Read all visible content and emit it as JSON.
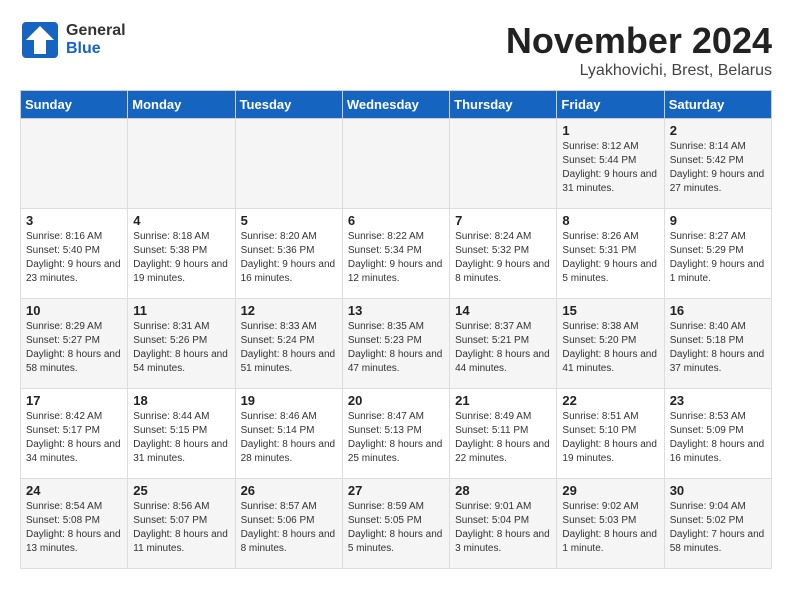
{
  "logo": {
    "general": "General",
    "blue": "Blue"
  },
  "header": {
    "month": "November 2024",
    "location": "Lyakhovichi, Brest, Belarus"
  },
  "weekdays": [
    "Sunday",
    "Monday",
    "Tuesday",
    "Wednesday",
    "Thursday",
    "Friday",
    "Saturday"
  ],
  "weeks": [
    [
      {
        "day": "",
        "info": ""
      },
      {
        "day": "",
        "info": ""
      },
      {
        "day": "",
        "info": ""
      },
      {
        "day": "",
        "info": ""
      },
      {
        "day": "",
        "info": ""
      },
      {
        "day": "1",
        "info": "Sunrise: 8:12 AM\nSunset: 5:44 PM\nDaylight: 9 hours and 31 minutes."
      },
      {
        "day": "2",
        "info": "Sunrise: 8:14 AM\nSunset: 5:42 PM\nDaylight: 9 hours and 27 minutes."
      }
    ],
    [
      {
        "day": "3",
        "info": "Sunrise: 8:16 AM\nSunset: 5:40 PM\nDaylight: 9 hours and 23 minutes."
      },
      {
        "day": "4",
        "info": "Sunrise: 8:18 AM\nSunset: 5:38 PM\nDaylight: 9 hours and 19 minutes."
      },
      {
        "day": "5",
        "info": "Sunrise: 8:20 AM\nSunset: 5:36 PM\nDaylight: 9 hours and 16 minutes."
      },
      {
        "day": "6",
        "info": "Sunrise: 8:22 AM\nSunset: 5:34 PM\nDaylight: 9 hours and 12 minutes."
      },
      {
        "day": "7",
        "info": "Sunrise: 8:24 AM\nSunset: 5:32 PM\nDaylight: 9 hours and 8 minutes."
      },
      {
        "day": "8",
        "info": "Sunrise: 8:26 AM\nSunset: 5:31 PM\nDaylight: 9 hours and 5 minutes."
      },
      {
        "day": "9",
        "info": "Sunrise: 8:27 AM\nSunset: 5:29 PM\nDaylight: 9 hours and 1 minute."
      }
    ],
    [
      {
        "day": "10",
        "info": "Sunrise: 8:29 AM\nSunset: 5:27 PM\nDaylight: 8 hours and 58 minutes."
      },
      {
        "day": "11",
        "info": "Sunrise: 8:31 AM\nSunset: 5:26 PM\nDaylight: 8 hours and 54 minutes."
      },
      {
        "day": "12",
        "info": "Sunrise: 8:33 AM\nSunset: 5:24 PM\nDaylight: 8 hours and 51 minutes."
      },
      {
        "day": "13",
        "info": "Sunrise: 8:35 AM\nSunset: 5:23 PM\nDaylight: 8 hours and 47 minutes."
      },
      {
        "day": "14",
        "info": "Sunrise: 8:37 AM\nSunset: 5:21 PM\nDaylight: 8 hours and 44 minutes."
      },
      {
        "day": "15",
        "info": "Sunrise: 8:38 AM\nSunset: 5:20 PM\nDaylight: 8 hours and 41 minutes."
      },
      {
        "day": "16",
        "info": "Sunrise: 8:40 AM\nSunset: 5:18 PM\nDaylight: 8 hours and 37 minutes."
      }
    ],
    [
      {
        "day": "17",
        "info": "Sunrise: 8:42 AM\nSunset: 5:17 PM\nDaylight: 8 hours and 34 minutes."
      },
      {
        "day": "18",
        "info": "Sunrise: 8:44 AM\nSunset: 5:15 PM\nDaylight: 8 hours and 31 minutes."
      },
      {
        "day": "19",
        "info": "Sunrise: 8:46 AM\nSunset: 5:14 PM\nDaylight: 8 hours and 28 minutes."
      },
      {
        "day": "20",
        "info": "Sunrise: 8:47 AM\nSunset: 5:13 PM\nDaylight: 8 hours and 25 minutes."
      },
      {
        "day": "21",
        "info": "Sunrise: 8:49 AM\nSunset: 5:11 PM\nDaylight: 8 hours and 22 minutes."
      },
      {
        "day": "22",
        "info": "Sunrise: 8:51 AM\nSunset: 5:10 PM\nDaylight: 8 hours and 19 minutes."
      },
      {
        "day": "23",
        "info": "Sunrise: 8:53 AM\nSunset: 5:09 PM\nDaylight: 8 hours and 16 minutes."
      }
    ],
    [
      {
        "day": "24",
        "info": "Sunrise: 8:54 AM\nSunset: 5:08 PM\nDaylight: 8 hours and 13 minutes."
      },
      {
        "day": "25",
        "info": "Sunrise: 8:56 AM\nSunset: 5:07 PM\nDaylight: 8 hours and 11 minutes."
      },
      {
        "day": "26",
        "info": "Sunrise: 8:57 AM\nSunset: 5:06 PM\nDaylight: 8 hours and 8 minutes."
      },
      {
        "day": "27",
        "info": "Sunrise: 8:59 AM\nSunset: 5:05 PM\nDaylight: 8 hours and 5 minutes."
      },
      {
        "day": "28",
        "info": "Sunrise: 9:01 AM\nSunset: 5:04 PM\nDaylight: 8 hours and 3 minutes."
      },
      {
        "day": "29",
        "info": "Sunrise: 9:02 AM\nSunset: 5:03 PM\nDaylight: 8 hours and 1 minute."
      },
      {
        "day": "30",
        "info": "Sunrise: 9:04 AM\nSunset: 5:02 PM\nDaylight: 7 hours and 58 minutes."
      }
    ]
  ]
}
